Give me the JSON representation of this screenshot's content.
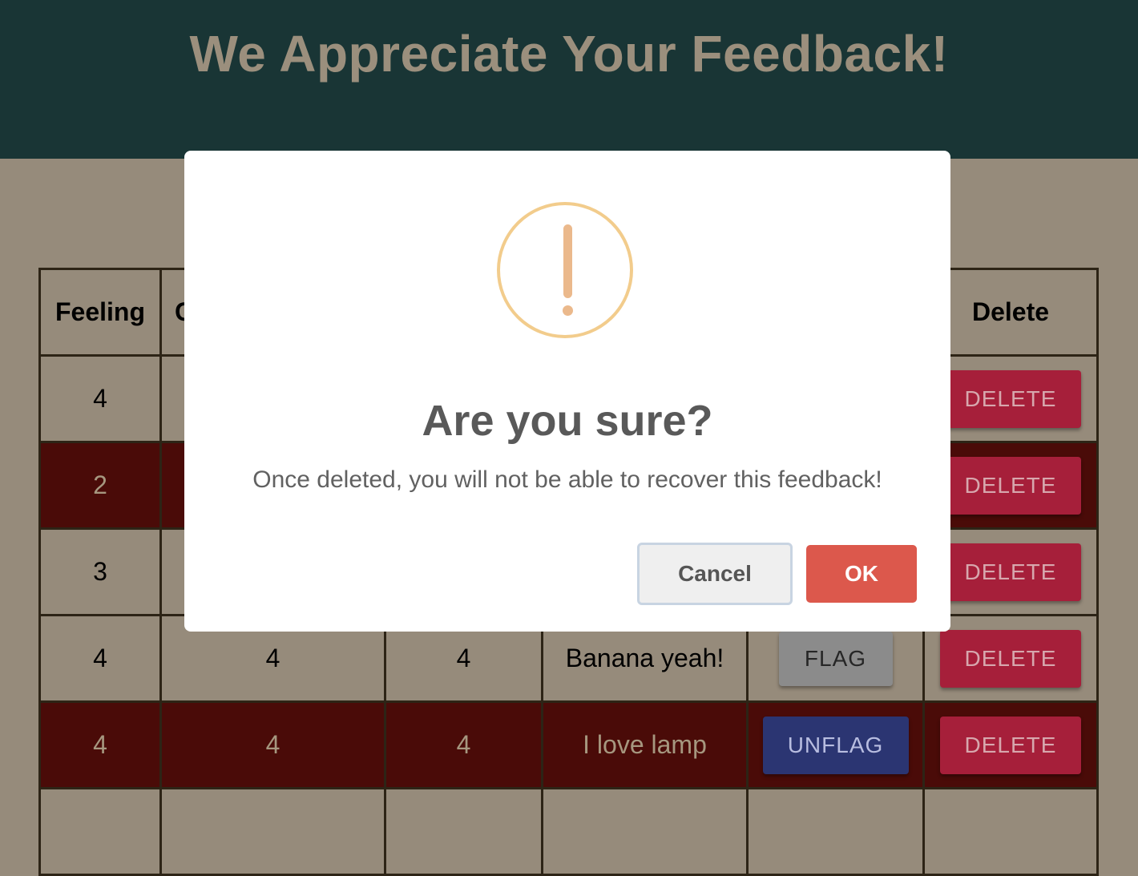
{
  "header": {
    "title": "We Appreciate Your Feedback!"
  },
  "table": {
    "columns": [
      "Feeling",
      "C",
      "",
      "",
      "",
      "Delete"
    ],
    "rows": [
      {
        "feeling": "4",
        "understanding": "",
        "support": "",
        "comments": "",
        "flag_label": "",
        "delete_label": "DELETE",
        "flagged": false
      },
      {
        "feeling": "2",
        "understanding": "",
        "support": "",
        "comments": "",
        "flag_label": "",
        "delete_label": "DELETE",
        "flagged": true
      },
      {
        "feeling": "3",
        "understanding": "",
        "support": "",
        "comments": "",
        "flag_label": "",
        "delete_label": "DELETE",
        "flagged": false
      },
      {
        "feeling": "4",
        "understanding": "4",
        "support": "4",
        "comments": "Banana yeah!",
        "flag_label": "FLAG",
        "delete_label": "DELETE",
        "flagged": false
      },
      {
        "feeling": "4",
        "understanding": "4",
        "support": "4",
        "comments": "I love lamp",
        "flag_label": "UNFLAG",
        "delete_label": "DELETE",
        "flagged": true
      }
    ]
  },
  "modal": {
    "icon": "warning-exclamation-icon",
    "title": "Are you sure?",
    "text": "Once deleted, you will not be able to recover this feedback!",
    "cancel_label": "Cancel",
    "ok_label": "OK"
  },
  "colors": {
    "header_bg": "#193535",
    "page_bg": "#968b7b",
    "flagged_row_bg": "#4a0b08",
    "delete_button": "#a61f3a",
    "unflag_button": "#2b3572",
    "ok_button": "#dc584c",
    "warning_icon": "#f2cc8c"
  }
}
